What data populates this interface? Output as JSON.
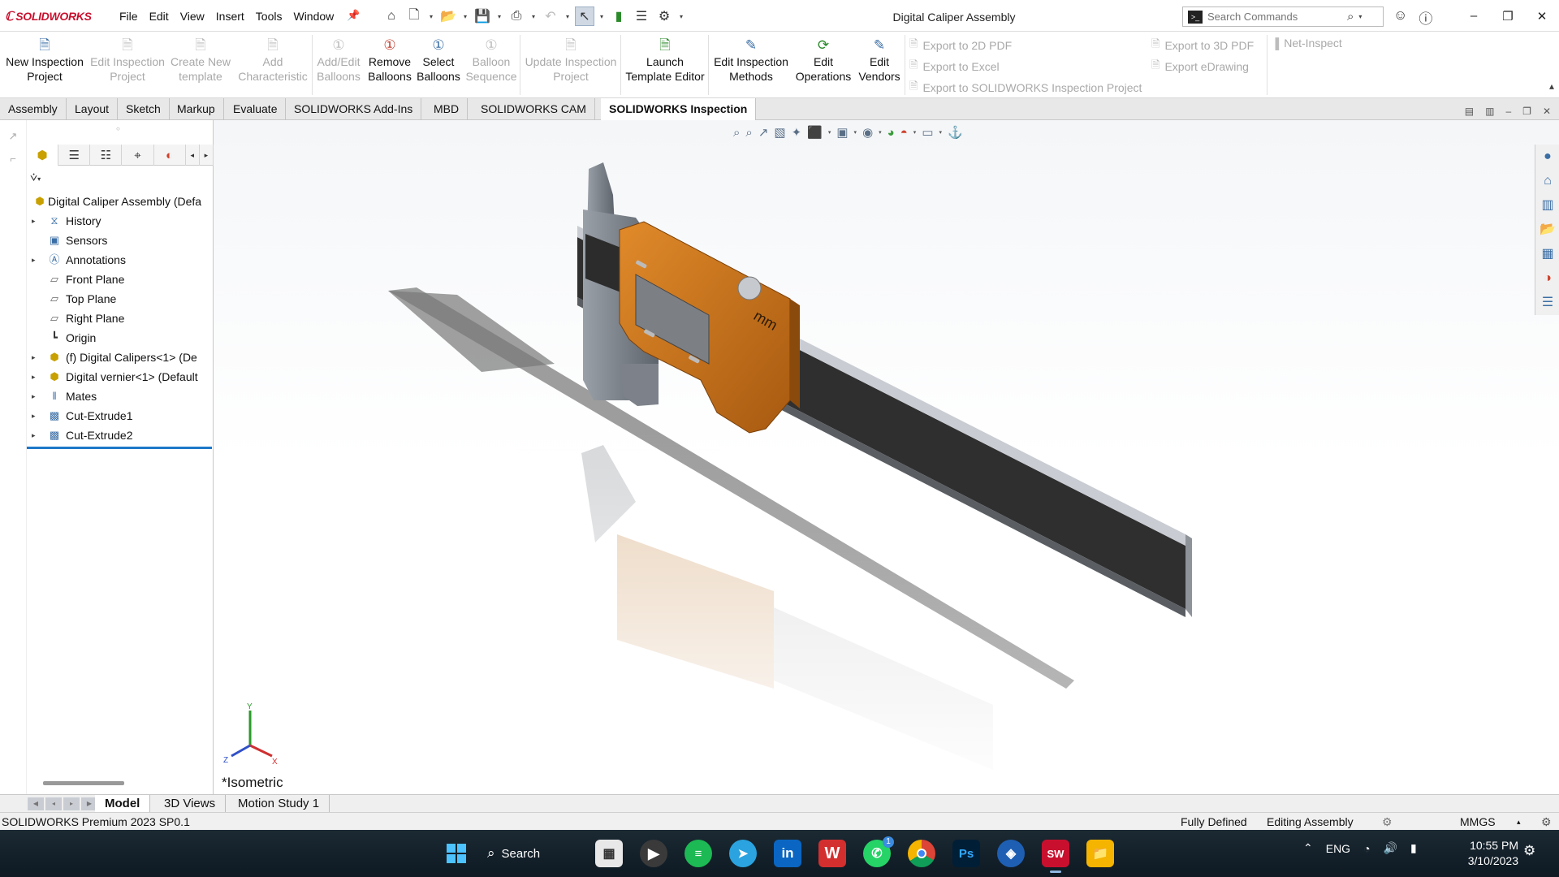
{
  "app": {
    "logo": "SOLIDWORKS",
    "window_title": "Digital Caliper Assembly",
    "menu": [
      "File",
      "Edit",
      "View",
      "Insert",
      "Tools",
      "Window"
    ],
    "search_placeholder": "Search Commands"
  },
  "ribbon": {
    "buttons": [
      {
        "label1": "New Inspection",
        "label2": "Project",
        "enabled": true,
        "icon": "new-inspection-icon"
      },
      {
        "label1": "Edit Inspection",
        "label2": "Project",
        "enabled": false,
        "icon": "edit-inspection-icon"
      },
      {
        "label1": "Create New",
        "label2": "template",
        "enabled": false,
        "icon": "template-icon"
      },
      {
        "label1": "Add",
        "label2": "Characteristic",
        "enabled": false,
        "icon": "characteristic-icon"
      },
      {
        "label1": "Add/Edit",
        "label2": "Balloons",
        "enabled": false,
        "icon": "balloon-icon"
      },
      {
        "label1": "Remove",
        "label2": "Balloons",
        "enabled": true,
        "icon": "remove-balloon-icon"
      },
      {
        "label1": "Select",
        "label2": "Balloons",
        "enabled": true,
        "icon": "select-balloon-icon"
      },
      {
        "label1": "Balloon",
        "label2": "Sequence",
        "enabled": false,
        "icon": "sequence-icon"
      },
      {
        "label1": "Update Inspection",
        "label2": "Project",
        "enabled": false,
        "icon": "update-icon"
      },
      {
        "label1": "Launch",
        "label2": "Template Editor",
        "enabled": true,
        "icon": "template-editor-icon"
      },
      {
        "label1": "Edit Inspection",
        "label2": "Methods",
        "enabled": true,
        "icon": "methods-icon"
      },
      {
        "label1": "Edit",
        "label2": "Operations",
        "enabled": true,
        "icon": "operations-icon"
      },
      {
        "label1": "Edit",
        "label2": "Vendors",
        "enabled": true,
        "icon": "vendors-icon"
      }
    ],
    "exports": [
      "Export to 2D PDF",
      "Export to Excel",
      "Export to SOLIDWORKS Inspection Project",
      "Export to 3D PDF",
      "Export eDrawing",
      "Net-Inspect"
    ]
  },
  "tabs": [
    "Assembly",
    "Layout",
    "Sketch",
    "Markup",
    "Evaluate",
    "SOLIDWORKS Add-Ins",
    "MBD",
    "SOLIDWORKS CAM",
    "SOLIDWORKS Inspection"
  ],
  "active_tab": "SOLIDWORKS Inspection",
  "tree": [
    {
      "label": "Digital Caliper Assembly (Defa",
      "expander": false,
      "level": 0,
      "icon": "assembly-icon"
    },
    {
      "label": "History",
      "expander": true,
      "level": 1,
      "icon": "history-icon"
    },
    {
      "label": "Sensors",
      "expander": false,
      "level": 1,
      "icon": "sensors-icon"
    },
    {
      "label": "Annotations",
      "expander": true,
      "level": 1,
      "icon": "annotations-icon"
    },
    {
      "label": "Front Plane",
      "expander": false,
      "level": 1,
      "icon": "plane-icon"
    },
    {
      "label": "Top Plane",
      "expander": false,
      "level": 1,
      "icon": "plane-icon"
    },
    {
      "label": "Right Plane",
      "expander": false,
      "level": 1,
      "icon": "plane-icon"
    },
    {
      "label": "Origin",
      "expander": false,
      "level": 1,
      "icon": "origin-icon"
    },
    {
      "label": "(f) Digital Calipers<1> (De",
      "expander": true,
      "level": 1,
      "icon": "part-icon"
    },
    {
      "label": "Digital vernier<1> (Default",
      "expander": true,
      "level": 1,
      "icon": "part-icon"
    },
    {
      "label": "Mates",
      "expander": true,
      "level": 1,
      "icon": "mates-icon"
    },
    {
      "label": "Cut-Extrude1",
      "expander": true,
      "level": 1,
      "icon": "cut-extrude-icon"
    },
    {
      "label": "Cut-Extrude2",
      "expander": true,
      "level": 1,
      "icon": "cut-extrude-icon"
    }
  ],
  "viewport": {
    "view_name": "*Isometric",
    "display_text": "mm",
    "triad": {
      "x": "X",
      "y": "Y",
      "z": "Z"
    }
  },
  "bottom_tabs": [
    "Model",
    "3D Views",
    "Motion Study 1"
  ],
  "status": {
    "product": "SOLIDWORKS Premium 2023 SP0.1",
    "state": "Fully Defined",
    "mode": "Editing Assembly",
    "units": "MMGS"
  },
  "taskbar": {
    "search_label": "Search",
    "lang": "ENG",
    "time": "10:55 PM",
    "date": "3/10/2023",
    "whatsapp_badge": "1",
    "ps_label": "Ps",
    "sw_label": "SW"
  }
}
